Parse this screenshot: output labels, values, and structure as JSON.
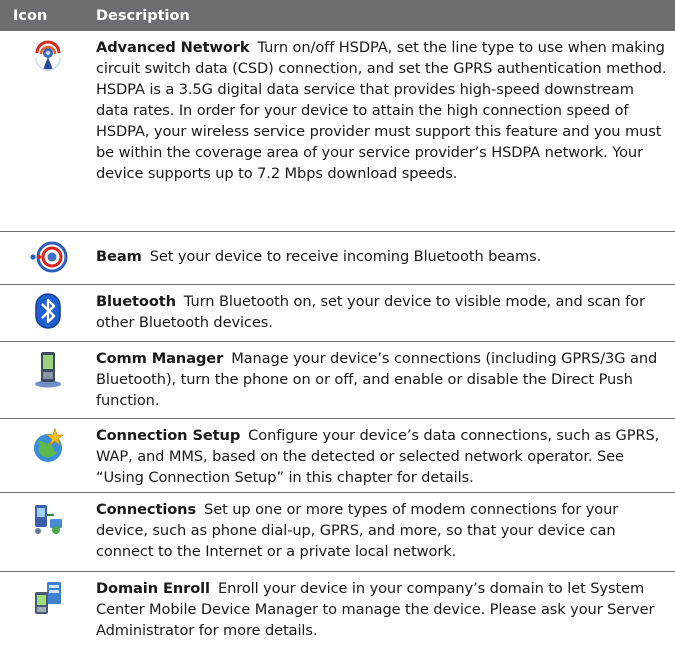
{
  "header": {
    "icon_col": "Icon",
    "description_col": "Description"
  },
  "rows": [
    {
      "icon": "advanced-network-icon",
      "title": "Advanced Network",
      "text": "Turn on/off HSDPA, set the line type to use when making circuit switch data (CSD) connection, and set the GPRS authentication method. HSDPA is a 3.5G digital data service that provides high-speed downstream data rates. In order for your device to attain the high connection speed of HSDPA, your wireless service provider must support this feature and you must be within the coverage area of your service provider’s HSDPA network. Your device supports up to 7.2 Mbps download speeds."
    },
    {
      "icon": "beam-icon",
      "title": "Beam",
      "text": "Set your device to receive incoming Bluetooth beams."
    },
    {
      "icon": "bluetooth-icon",
      "title": "Bluetooth",
      "text": "Turn Bluetooth on, set your device to visible mode, and scan for other Bluetooth devices."
    },
    {
      "icon": "comm-manager-icon",
      "title": "Comm Manager",
      "text": "Manage your device’s connections (including GPRS/3G and Bluetooth), turn the phone on or off, and enable or disable the Direct Push function."
    },
    {
      "icon": "connection-setup-icon",
      "title": "Connection Setup",
      "text": "Configure your device’s data connections, such as GPRS, WAP, and MMS, based on the detected or selected network operator. See “Using Connection Setup” in this chapter for details."
    },
    {
      "icon": "connections-icon",
      "title": "Connections",
      "text": "Set up one or more types of modem connections for your device, such as phone dial-up, GPRS, and more, so that your device can connect to the Internet or a private local network."
    },
    {
      "icon": "domain-enroll-icon",
      "title": "Domain Enroll",
      "text": "Enroll your device in your company’s domain to let System Center Mobile Device Manager to manage the device. Please ask your Server Administrator for more details."
    }
  ]
}
